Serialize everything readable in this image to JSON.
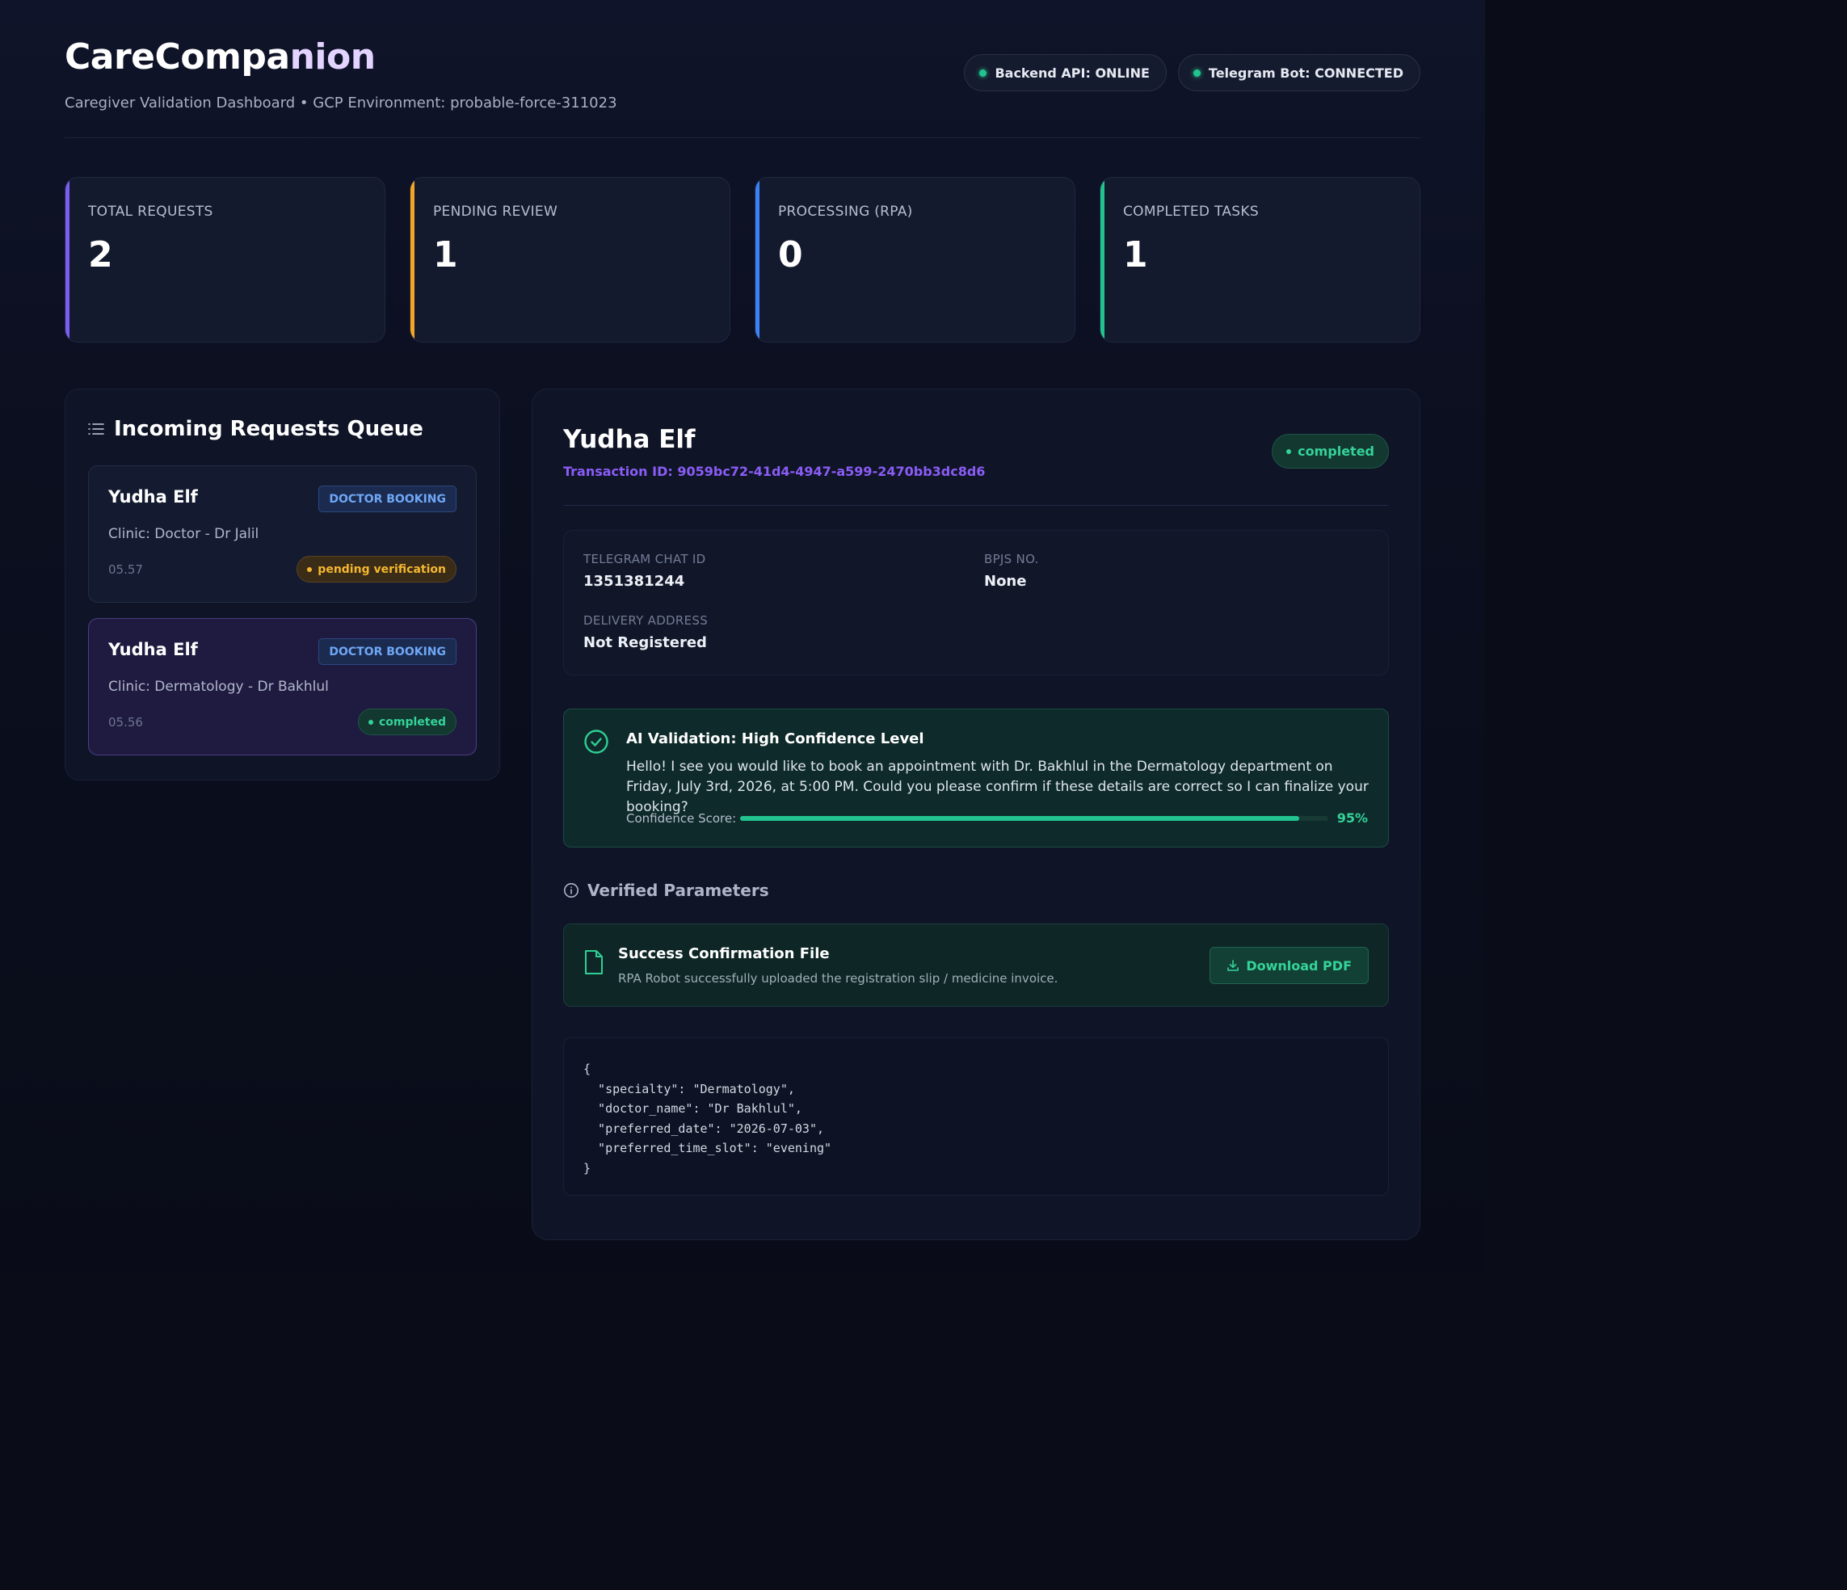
{
  "header": {
    "brand_part1": "CareCompa",
    "brand_part2": "nion",
    "subtitle": "Caregiver Validation Dashboard • GCP Environment: probable-force-311023",
    "status": [
      {
        "label": "Backend API: ONLINE"
      },
      {
        "label": "Telegram Bot: CONNECTED"
      }
    ]
  },
  "stats": [
    {
      "label": "TOTAL REQUESTS",
      "value": "2",
      "accent": "#7c5cf2"
    },
    {
      "label": "PENDING REVIEW",
      "value": "1",
      "accent": "#f5a524"
    },
    {
      "label": "PROCESSING (RPA)",
      "value": "0",
      "accent": "#3b82f6"
    },
    {
      "label": "COMPLETED TASKS",
      "value": "1",
      "accent": "#22c38e"
    }
  ],
  "queue": {
    "title": "Incoming Requests Queue",
    "items": [
      {
        "name": "Yudha Elf",
        "type": "DOCTOR BOOKING",
        "clinic": "Clinic: Doctor - Dr Jalil",
        "time": "05.57",
        "status": "pending verification"
      },
      {
        "name": "Yudha Elf",
        "type": "DOCTOR BOOKING",
        "clinic": "Clinic: Dermatology - Dr Bakhlul",
        "time": "05.56",
        "status": "completed"
      }
    ]
  },
  "detail": {
    "name": "Yudha Elf",
    "transaction": "Transaction ID: 9059bc72-41d4-4947-a599-2470bb3dc8d6",
    "status": "completed",
    "info": {
      "chat_label": "TELEGRAM CHAT ID",
      "chat_value": "1351381244",
      "bpjs_label": "BPJS NO.",
      "bpjs_value": "None",
      "address_label": "DELIVERY ADDRESS",
      "address_value": "Not Registered"
    },
    "ai": {
      "title": "AI Validation: High Confidence Level",
      "message": "Hello! I see you would like to book an appointment with Dr. Bakhlul in the Dermatology department on Friday, July 3rd, 2026, at 5:00 PM. Could you please confirm if these details are correct so I can finalize your booking?",
      "score_label": "Confidence Score:",
      "score": 95,
      "score_text": "95%"
    },
    "verified_title": "Verified Parameters",
    "file": {
      "title": "Success Confirmation File",
      "subtitle": "RPA Robot successfully uploaded the registration slip / medicine invoice.",
      "button": "Download PDF"
    },
    "json_text": "{\n  \"specialty\": \"Dermatology\",\n  \"doctor_name\": \"Dr Bakhlul\",\n  \"preferred_date\": \"2026-07-03\",\n  \"preferred_time_slot\": \"evening\"\n}"
  }
}
